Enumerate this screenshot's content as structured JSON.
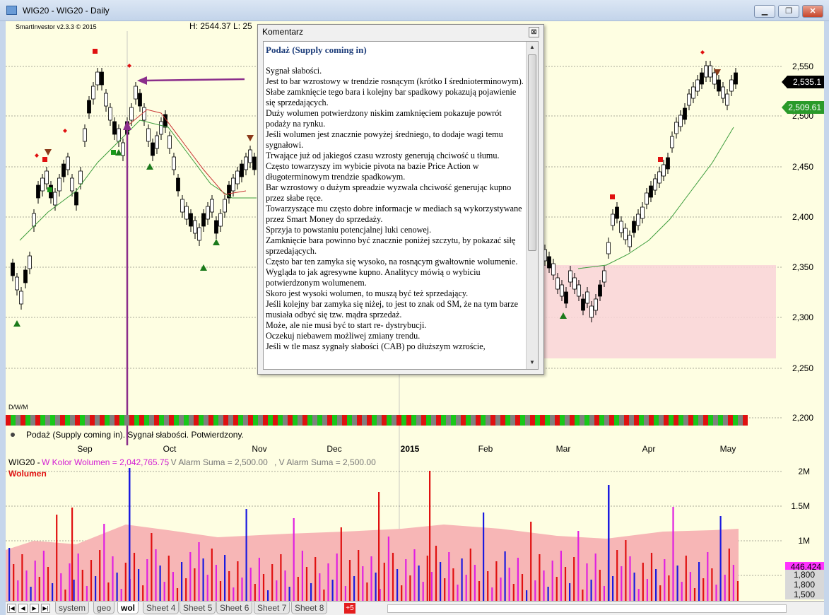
{
  "window": {
    "title": "WIG20 - WIG20 - Daily",
    "minimize": "▁",
    "restore": "❐",
    "close": "✕"
  },
  "header": {
    "version": "SmartInvestor v2.3.3 © 2015",
    "hl": "H: 2544.37  L: 25"
  },
  "price_axis": {
    "ticks": [
      "2,550",
      "2,500",
      "2,450",
      "2,400",
      "2,350",
      "2,300",
      "2,250",
      "2,200"
    ],
    "last_price": "2,535.1",
    "ma_value": "2,509.61"
  },
  "timeframe_label": "D/W/M",
  "signal_line": "Podaż (Supply coming in). Sygnał  słabości. Potwierdzony.",
  "months": [
    "Sep",
    "Oct",
    "Nov",
    "Dec",
    "2015",
    "Feb",
    "Mar",
    "Apr",
    "May"
  ],
  "volume_panel": {
    "legend_prefix": "WIG20 - ",
    "legend_kolor": "W Kolor Wolumen = 2,042,765.75",
    "legend_alarm1": ", V Alarm Suma = 2,500.00",
    "legend_alarm2": ", V Alarm Suma = 2,500.00",
    "title": "Wolumen",
    "ticks": [
      "2M",
      "1.5M",
      "1M"
    ],
    "last_value": "446,424",
    "alarm_values": [
      "1,800",
      "1,800",
      "1,500"
    ]
  },
  "popup": {
    "title": "Komentarz",
    "close": "⊠",
    "heading": "Podaż  (Supply coming in)",
    "lines": [
      "Sygnał  słabości.",
      "Jest to bar wzrostowy  w  trendzie  rosnącym (krótko  I średnioterminowym).",
      "Słabe zamknięcie tego bara  i kolejny bar spadkowy  pokazują pojawienie się sprzedających.",
      "Duży wolumen potwierdzony niskim zamknięciem  pokazuje powrót podaży na rynku.",
      "Jeśli wolumen jest znacznie powyżej średniego, to dodaje wagi temu sygnałowi.",
      "Trwające już od jakiegoś czasu wzrosty  generują chciwość  u tłumu.",
      "Często towarzyszy im  wybicie pivota na bazie Price Action w długoterminowym trendzie spadkowym.",
      "Bar wzrostowy o dużym spreadzie wyzwala  chciwość  generując kupno przez słabe ręce.",
      "Towarzyszące mu często dobre  informacje w mediach są wykorzystywane przez Smart Money do sprzedaży.",
      "Sprzyja to powstaniu potencjalnej  luki cenowej.",
      "Zamknięcie bara powinno być znacznie poniżej szczytu, by pokazać siłę sprzedających.",
      "Często bar ten zamyka się  wysoko, na rosnącym gwałtownie wolumenie. Wygląda to jak agresywne kupno. Analitycy mówią o wybiciu potwierdzonym wolumenem.",
      "Skoro jest  wysoki wolumen, to muszą być też sprzedający.",
      "Jeśli kolejny bar zamyka się niżej, to jest to znak od SM, że na tym barze musiała odbyć się tzw. mądra sprzedaż.",
      "Może, ale nie musi być to start re- dystrybucji.",
      "Oczekuj niebawem możliwej zmiany trendu.",
      "Jeśli w tle masz  sygnały słabości (CAB)  po dłuższym wzroście,"
    ]
  },
  "sheets": {
    "tabs": [
      "system",
      "geo",
      "wol",
      "Sheet 4",
      "Sheet 5",
      "Sheet 6",
      "Sheet 7",
      "Sheet 8"
    ],
    "active": "wol",
    "badge": "+5",
    "nav": [
      "|◀",
      "◀",
      "▶",
      "▶|"
    ]
  }
}
